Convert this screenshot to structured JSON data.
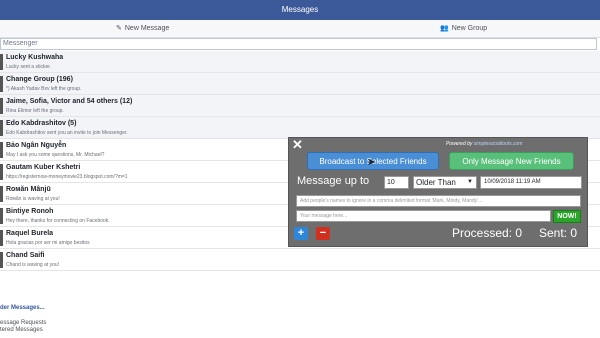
{
  "header": {
    "title": "Messages"
  },
  "actions": {
    "new_message": "New Message",
    "new_group": "New Group"
  },
  "search": {
    "placeholder": "Messenger"
  },
  "threads": [
    {
      "name": "Lucky Kushwaha",
      "snippet": "Lucky sent a sticker."
    },
    {
      "name": "Change Group (196)",
      "snippet": "*) Akash Yadav Bxv left the group."
    },
    {
      "name": "Jaime, Sofia, Victor and 54 others (12)",
      "snippet": "Rina Elimor left the group."
    },
    {
      "name": "Edo Kabdrashitov (5)",
      "snippet": "Edo Kabdrashitov sent you an invite to join Messenger."
    },
    {
      "name": "Bảo Ngân Nguyễn",
      "snippet": "May I ask you some questions, Mr. Michael?"
    },
    {
      "name": "Gautam Kuber Kshetri",
      "snippet": "https://registernow-moneymovie23.blogspot.com/?m=1"
    },
    {
      "name": "Rомăn Mânjū",
      "snippet": "Rомăn is waving at you!"
    },
    {
      "name": "Bintiye Ronoh",
      "snippet": "Hey there, thanks for connecting on Facebook."
    },
    {
      "name": "Raquel Burela",
      "snippet": "Hola gracias por ser mi amigo besitos"
    },
    {
      "name": "Chand Saifi",
      "snippet": "Chand is waving at you!"
    }
  ],
  "older_link": "der Messages...",
  "footer_links": [
    "essage Requests",
    "tered Messages"
  ],
  "panel": {
    "powered_prefix": "Powered by ",
    "powered_link": "simplesocialtools.com",
    "broadcast_button": "Broadcast to Selected Friends",
    "only_new_button": "Only Message New Friends",
    "message_up_to_label": "Message up to",
    "count_value": "10",
    "older_than_value": "Older Than",
    "date_value": "10/09/2018 11:19 AM",
    "ignore_placeholder": "Add people's names to ignore in a comma delimited format 'Mark, Mindy, Mandy'...",
    "message_placeholder": "Your message here...",
    "now_button": "NOW!",
    "plus_label": "+",
    "minus_label": "−",
    "processed_label": "Processed: 0",
    "sent_label": "Sent: 0"
  },
  "colors": {
    "header_bg": "#3b5998",
    "panel_bg": "#6e6e6e",
    "broadcast_bg": "#4a8fd6",
    "only_new_bg": "#59c07b",
    "now_bg": "#2aa52a"
  },
  "icons": {
    "new_message": "compose-icon",
    "new_group": "group-icon",
    "close": "close-icon",
    "select": "chevron-down-icon"
  }
}
